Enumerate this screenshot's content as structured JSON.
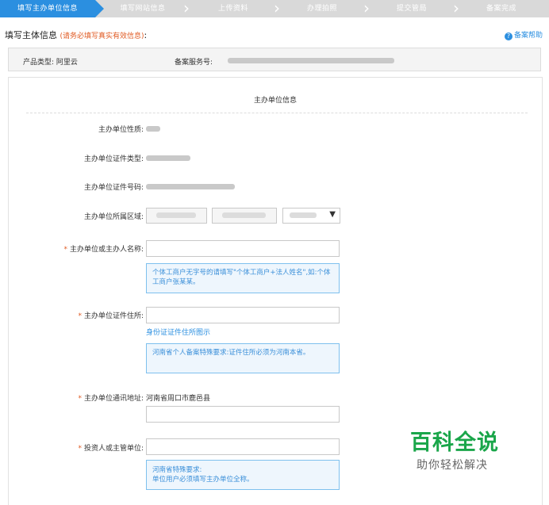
{
  "steps": [
    {
      "label": "填写主办单位信息",
      "active": true
    },
    {
      "label": "填写网站信息",
      "active": false
    },
    {
      "label": "上传资料",
      "active": false
    },
    {
      "label": "办理拍照",
      "active": false
    },
    {
      "label": "提交管局",
      "active": false
    },
    {
      "label": "备案完成",
      "active": false
    }
  ],
  "header": {
    "title": "填写主体信息",
    "note": "(请务必填写真实有效信息)",
    "colon": ":",
    "help": "备案帮助"
  },
  "infobar": {
    "product_label": "产品类型:",
    "product_value": "阿里云",
    "service_label": "备案服务号:"
  },
  "form": {
    "section_title": "主办单位信息",
    "nature_label": "主办单位性质:",
    "cert_type_label": "主办单位证件类型:",
    "cert_no_label": "主办单位证件号码:",
    "region_label": "主办单位所属区域:",
    "name_label": "主办单位或主办人名称:",
    "name_tip": "个体工商户无字号的请填写\"个体工商户+法人姓名\",如:个体工商户张某某。",
    "address_label": "主办单位证件住所:",
    "address_link": "身份证证件住所图示",
    "address_tip": "河南省个人备案特殊要求:证件住所必须为河南本省。",
    "comm_label": "主办单位通讯地址:",
    "comm_value": "河南省周口市鹿邑县",
    "investor_label": "投资人或主管单位:",
    "investor_tip_1": "河南省特殊要求:",
    "investor_tip_2": "单位用户必须填写主办单位全称。",
    "required_mark": "*"
  },
  "watermark": {
    "title": "百科全说",
    "subtitle": "助你轻松解决"
  },
  "colors": {
    "accent": "#2b8fe0",
    "warning": "#e05a22",
    "watermark": "#1aa64a"
  }
}
